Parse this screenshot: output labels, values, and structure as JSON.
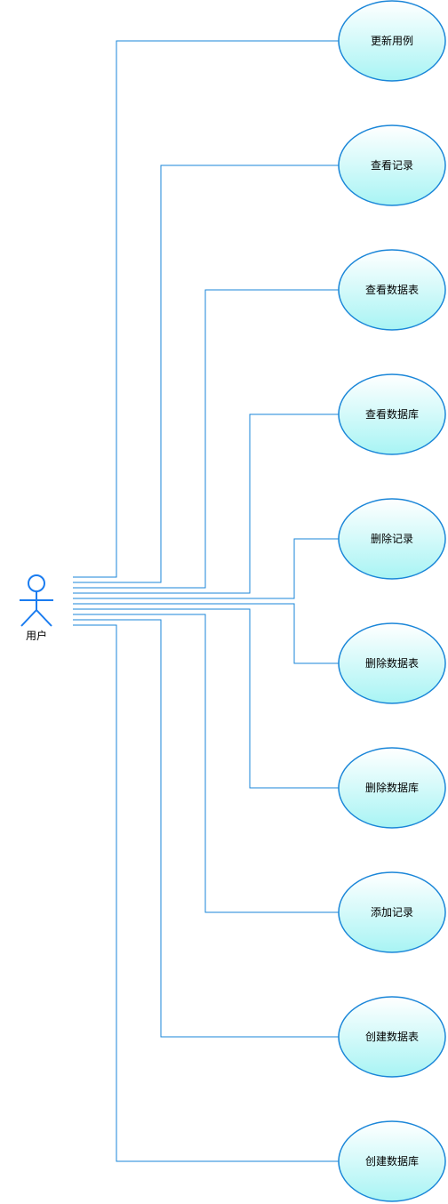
{
  "diagram": {
    "actor": {
      "label": "用户",
      "icon": "stick-figure-icon"
    },
    "use_cases": [
      {
        "id": "uc-1",
        "label": "更新用例"
      },
      {
        "id": "uc-2",
        "label": "查看记录"
      },
      {
        "id": "uc-3",
        "label": "查看数据表"
      },
      {
        "id": "uc-4",
        "label": "查看数据库"
      },
      {
        "id": "uc-5",
        "label": "删除记录"
      },
      {
        "id": "uc-6",
        "label": "删除数据表"
      },
      {
        "id": "uc-7",
        "label": "删除数据库"
      },
      {
        "id": "uc-8",
        "label": "添加记录"
      },
      {
        "id": "uc-9",
        "label": "创建数据表"
      },
      {
        "id": "uc-10",
        "label": "创建数据库"
      }
    ],
    "colors": {
      "actor_stroke": "#1a7cf0",
      "connector": "#1a86d8",
      "ellipse_stroke": "#1a86d8",
      "ellipse_fill_top": "#ffffff",
      "ellipse_fill_bottom": "#a8f4f4"
    }
  }
}
